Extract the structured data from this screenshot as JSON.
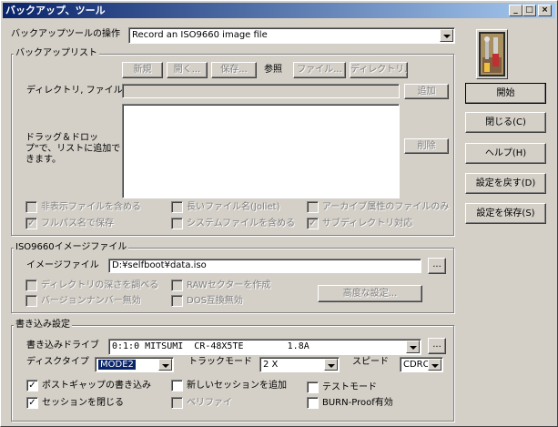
{
  "window": {
    "title": "バックアップ、ツール",
    "minimize": "_",
    "maximize": "□",
    "close": "×"
  },
  "operation": {
    "label": "バックアップツールの操作",
    "value": "Record an ISO9660 image file"
  },
  "backup_list": {
    "title": "バックアップリスト",
    "new": "新規",
    "open": "開く...",
    "save": "保存...",
    "browse_label": "参照",
    "file_btn": "ファイル...",
    "dir_btn": "ディレクトリ...",
    "dir_file_label": "ディレクトリ, ファイル",
    "add": "追加",
    "drag_label": "ドラッグ＆ドロップ\"で、リストに追加できます。",
    "remove": "削除",
    "options": [
      {
        "label": "非表示ファイルを含める",
        "checked": false
      },
      {
        "label": "長いファイル名(Joliet)",
        "checked": false
      },
      {
        "label": "アーカイブ属性のファイルのみ",
        "checked": false
      },
      {
        "label": "フルパス名で保存",
        "checked": true
      },
      {
        "label": "システムファイルを含める",
        "checked": false
      },
      {
        "label": "サブディレクトリ対応",
        "checked": true
      }
    ]
  },
  "iso": {
    "title": "ISO9660イメージファイル",
    "image_label": "イメージファイル",
    "image_path": "D:¥selfboot¥data.iso",
    "browse": "...",
    "options": [
      {
        "label": "ディレクトリの深さを調べる",
        "checked": false
      },
      {
        "label": "RAWセクターを作成",
        "checked": false
      },
      {
        "label": "バージョンナンバー無効",
        "checked": false
      },
      {
        "label": "DOS互換無効",
        "checked": false
      }
    ],
    "advanced": "高度な設定..."
  },
  "write": {
    "title": "書き込み設定",
    "drive_label": "書き込みドライブ",
    "drive_value": "0:1:0 MITSUMI  CR-48X5TE        1.8A",
    "drive_browse": "...",
    "disc_type_label": "ディスクタイプ",
    "disc_type": "MODE2",
    "track_mode_label": "トラックモード",
    "track_mode": "2 X",
    "speed_label": "スピード",
    "speed": "CDRO",
    "options": [
      {
        "label": "ポストギャップの書き込み",
        "checked": true
      },
      {
        "label": "新しいセッションを追加",
        "checked": false
      },
      {
        "label": "テストモード",
        "checked": false
      },
      {
        "label": "セッションを閉じる",
        "checked": true
      },
      {
        "label": "ベリファイ",
        "checked": false
      },
      {
        "label": "BURN-Proof有効",
        "checked": false
      }
    ]
  },
  "side": {
    "start": "開始",
    "close": "閉じる(C)",
    "help": "ヘルプ(H)",
    "restore": "設定を戻す(D)",
    "save": "設定を保存(S)"
  },
  "icons": {
    "app": "tools-icon"
  }
}
